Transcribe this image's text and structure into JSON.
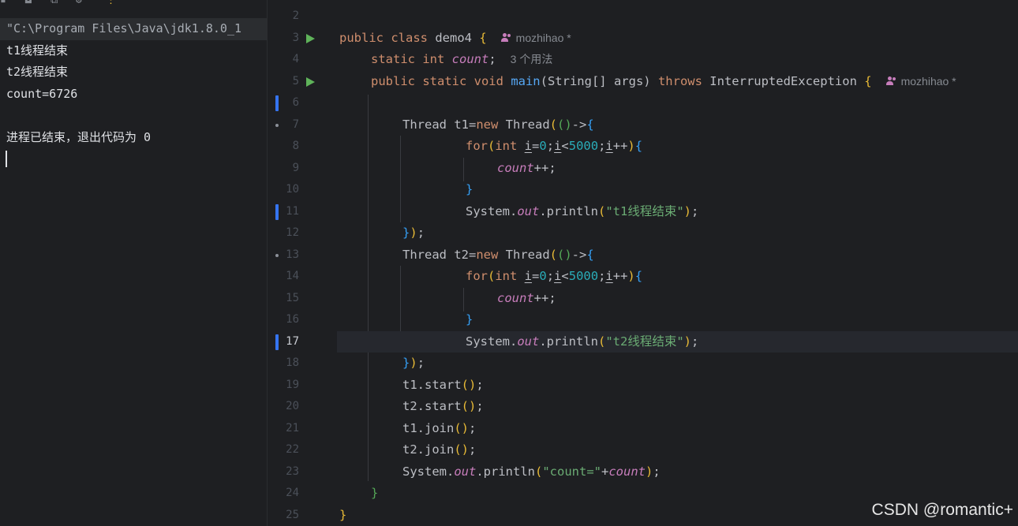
{
  "console": {
    "lines": [
      "\"C:\\Program Files\\Java\\jdk1.8.0_1",
      "t1线程结束",
      "t2线程结束",
      "count=6726",
      "",
      "进程已结束，退出代码为 0"
    ]
  },
  "editor": {
    "line_numbers": [
      "2",
      "3",
      "4",
      "5",
      "6",
      "7",
      "8",
      "9",
      "10",
      "11",
      "12",
      "13",
      "14",
      "15",
      "16",
      "17",
      "18",
      "19",
      "20",
      "21",
      "22",
      "23",
      "24",
      "25"
    ],
    "current_line": "17",
    "author": "mozhihao *",
    "usages_hint": "3 个用法",
    "code": {
      "l3_kw": "public class ",
      "l3_name": "demo4 ",
      "l3_brace": "{",
      "l4_kw": "static int ",
      "l4_field": "count",
      "l4_semi": ";",
      "l5_kw1": "public static void ",
      "l5_fn": "main",
      "l5_sig": "(String[] args) ",
      "l5_kw2": "throws ",
      "l5_exc": "InterruptedException ",
      "l5_brace": "{",
      "l7_text": "Thread t1=",
      "l7_new": "new ",
      "l7_thread": "Thread",
      "l7_lambda": "->",
      "for_kw": "for",
      "int_kw": "int ",
      "i_var": "i",
      "eq": "=",
      "zero": "0",
      "lt": "<",
      "limit": "5000",
      "inc": "++",
      "count_field": "count",
      "count_inc": "++;",
      "close_brace": "}",
      "sys": "System.",
      "out": "out",
      "println": ".println",
      "t1_str": "\"t1线程结束\"",
      "t2_str": "\"t2线程结束\"",
      "l13_text": "Thread t2=",
      "t1_start": "t1.start",
      "t2_start": "t2.start",
      "t1_join": "t1.join",
      "t2_join": "t2.join",
      "count_str": "\"count=\"",
      "plus": "+",
      "semi": ";",
      "paren_semi": ");"
    }
  },
  "watermark": "CSDN @romantic+"
}
